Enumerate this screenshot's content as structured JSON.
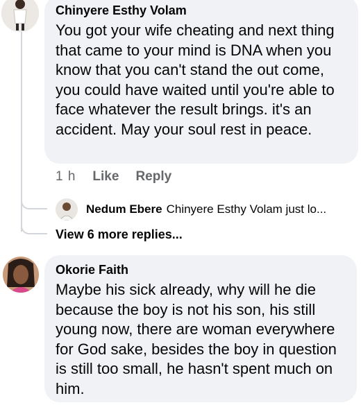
{
  "comments": [
    {
      "author": "Chinyere Esthy Volam",
      "text": "You got your wife cheating and next thing that came to your mind is DNA when you know that you can't stand the out come, you could have waited until you're able to face whatever the result brings. it's an accident. May your soul rest in peace.",
      "time": "1 h",
      "like_label": "Like",
      "reply_label": "Reply"
    },
    {
      "author": "Okorie Faith",
      "text": "Maybe his sick already, why will he die because the boy is not his son, his still young now, there are woman everywhere for God sake, besides the boy in question is still too small, he hasn't spent much on him."
    }
  ],
  "reply_preview": {
    "author": "Nedum Ebere",
    "snippet": "Chinyere Esthy Volam just lo..."
  },
  "view_more_label": "View 6 more replies..."
}
